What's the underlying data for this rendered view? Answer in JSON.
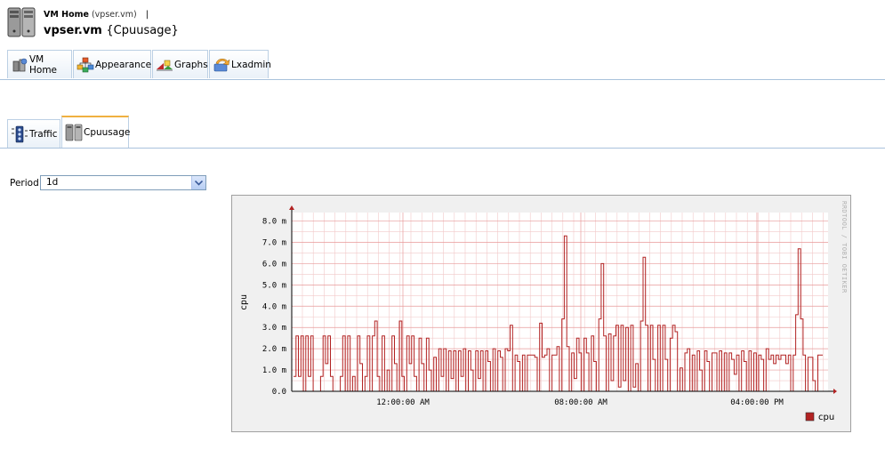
{
  "header": {
    "crumb_home": "VM Home",
    "crumb_host": "(vpser.vm)",
    "crumb_sep": "|",
    "title_host": "vpser.vm",
    "title_sub": "{Cpuusage}"
  },
  "main_tabs": [
    {
      "label": "VM Home",
      "icon": "vm-home-icon"
    },
    {
      "label": "Appearance",
      "icon": "appearance-icon"
    },
    {
      "label": "Graphs",
      "icon": "graphs-icon"
    },
    {
      "label": "Lxadmin",
      "icon": "lxadmin-icon"
    }
  ],
  "sub_tabs": [
    {
      "label": "Traffic",
      "icon": "traffic-icon",
      "active": false
    },
    {
      "label": "Cpuusage",
      "icon": "server-icon",
      "active": true
    }
  ],
  "period": {
    "label": "Period",
    "selected": "1d"
  },
  "colors": {
    "accent_line": "#a9c2dc",
    "series": "#b22222",
    "active_tab_top": "#f0b040"
  },
  "chart_data": {
    "type": "line",
    "ylabel": "cpu",
    "yticks": [
      "0.0",
      "1.0 m",
      "2.0 m",
      "3.0 m",
      "4.0 m",
      "5.0 m",
      "6.0 m",
      "7.0 m",
      "8.0 m"
    ],
    "ylim": [
      0,
      8.4
    ],
    "xticks": [
      "12:00:00 AM",
      "08:00:00 AM",
      "04:00:00 PM"
    ],
    "watermark": "RRDTOOL / TOBI OETIKER",
    "grid": true,
    "legend": {
      "position": "bottom-right"
    },
    "series": [
      {
        "name": "cpu",
        "values": [
          0.7,
          2.6,
          0.7,
          2.6,
          0.0,
          2.6,
          0.7,
          2.6,
          0.0,
          0.0,
          0.0,
          0.7,
          2.6,
          1.3,
          2.6,
          0.7,
          0.0,
          0.0,
          0.0,
          0.7,
          2.6,
          0.0,
          2.6,
          0.0,
          0.7,
          0.0,
          2.6,
          1.3,
          0.0,
          0.7,
          2.6,
          0.0,
          2.6,
          3.3,
          0.7,
          0.0,
          2.6,
          0.0,
          1.0,
          0.0,
          2.6,
          1.3,
          0.0,
          3.3,
          0.7,
          0.0,
          2.6,
          1.3,
          2.6,
          0.7,
          0.0,
          2.5,
          1.3,
          0.0,
          2.5,
          1.0,
          0.0,
          1.6,
          0.0,
          2.0,
          0.7,
          2.0,
          0.0,
          1.9,
          0.6,
          1.9,
          0.0,
          1.9,
          0.7,
          2.0,
          0.0,
          1.9,
          1.0,
          0.0,
          1.9,
          0.6,
          1.9,
          0.0,
          1.9,
          1.4,
          0.0,
          2.0,
          0.0,
          1.9,
          1.6,
          0.0,
          2.0,
          1.9,
          3.1,
          0.0,
          1.7,
          1.4,
          0.0,
          1.7,
          0.0,
          1.7,
          1.7,
          1.7,
          1.6,
          0.0,
          3.2,
          1.6,
          1.7,
          2.0,
          0.0,
          1.7,
          1.7,
          2.1,
          0.0,
          3.4,
          7.3,
          2.1,
          0.0,
          1.8,
          0.6,
          2.5,
          1.8,
          0.0,
          2.5,
          1.8,
          0.0,
          2.6,
          1.4,
          0.0,
          3.4,
          6.0,
          2.6,
          0.0,
          2.7,
          0.5,
          2.6,
          3.1,
          0.2,
          3.1,
          0.5,
          3.0,
          0.0,
          3.1,
          0.2,
          1.3,
          0.0,
          3.3,
          6.3,
          3.1,
          0.0,
          3.1,
          1.5,
          0.0,
          3.1,
          0.0,
          3.1,
          1.5,
          0.0,
          2.5,
          3.1,
          2.8,
          0.0,
          1.1,
          0.0,
          1.8,
          2.0,
          0.0,
          1.7,
          0.0,
          1.9,
          1.0,
          0.0,
          1.9,
          1.4,
          0.0,
          1.8,
          1.8,
          0.0,
          1.9,
          0.0,
          1.8,
          0.0,
          1.8,
          1.5,
          0.8,
          1.7,
          0.0,
          1.9,
          1.4,
          0.0,
          1.9,
          0.0,
          1.8,
          0.0,
          1.7,
          1.5,
          0.0,
          2.0,
          1.5,
          1.7,
          1.3,
          1.7,
          1.5,
          1.7,
          1.7,
          1.3,
          1.7,
          0.0,
          1.7,
          3.6,
          6.7,
          3.4,
          1.7,
          0.0,
          1.6,
          1.6,
          0.5,
          0.0,
          1.7,
          1.7
        ]
      }
    ]
  }
}
